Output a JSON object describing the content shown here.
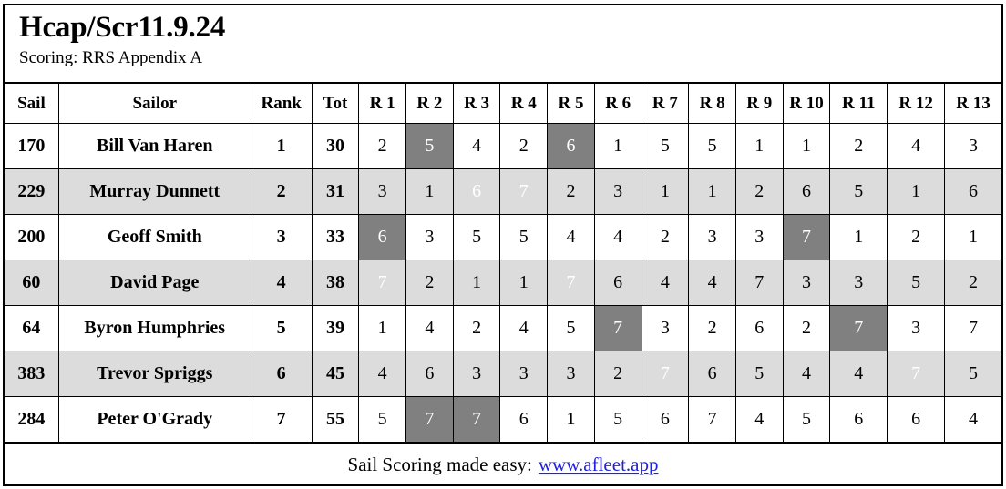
{
  "report": {
    "title": "Hcap/Scr11.9.24",
    "subtitle": "Scoring: RRS Appendix A"
  },
  "table": {
    "headers": {
      "sail": "Sail",
      "sailor": "Sailor",
      "rank": "Rank",
      "tot": "Tot",
      "races": [
        "R 1",
        "R 2",
        "R 3",
        "R 4",
        "R 5",
        "R 6",
        "R 7",
        "R 8",
        "R 9",
        "R 10",
        "R 11",
        "R 12",
        "R 13"
      ]
    },
    "rows": [
      {
        "sail": "170",
        "sailor": "Bill Van Haren",
        "rank": "1",
        "tot": "30",
        "races": [
          "2",
          "5",
          "4",
          "2",
          "6",
          "1",
          "5",
          "5",
          "1",
          "1",
          "2",
          "4",
          "3"
        ],
        "discards": [
          1,
          4
        ]
      },
      {
        "sail": "229",
        "sailor": "Murray Dunnett",
        "rank": "2",
        "tot": "31",
        "races": [
          "3",
          "1",
          "6",
          "7",
          "2",
          "3",
          "1",
          "1",
          "2",
          "6",
          "5",
          "1",
          "6"
        ],
        "discards": [
          2,
          3
        ]
      },
      {
        "sail": "200",
        "sailor": "Geoff Smith",
        "rank": "3",
        "tot": "33",
        "races": [
          "6",
          "3",
          "5",
          "5",
          "4",
          "4",
          "2",
          "3",
          "3",
          "7",
          "1",
          "2",
          "1"
        ],
        "discards": [
          0,
          9
        ]
      },
      {
        "sail": "60",
        "sailor": "David Page",
        "rank": "4",
        "tot": "38",
        "races": [
          "7",
          "2",
          "1",
          "1",
          "7",
          "6",
          "4",
          "4",
          "7",
          "3",
          "3",
          "5",
          "2"
        ],
        "discards": [
          0,
          4
        ]
      },
      {
        "sail": "64",
        "sailor": "Byron Humphries",
        "rank": "5",
        "tot": "39",
        "races": [
          "1",
          "4",
          "2",
          "4",
          "5",
          "7",
          "3",
          "2",
          "6",
          "2",
          "7",
          "3",
          "7"
        ],
        "discards": [
          5,
          10
        ]
      },
      {
        "sail": "383",
        "sailor": "Trevor Spriggs",
        "rank": "6",
        "tot": "45",
        "races": [
          "4",
          "6",
          "3",
          "3",
          "3",
          "2",
          "7",
          "6",
          "5",
          "4",
          "4",
          "7",
          "5"
        ],
        "discards": [
          6,
          11
        ]
      },
      {
        "sail": "284",
        "sailor": "Peter O'Grady",
        "rank": "7",
        "tot": "55",
        "races": [
          "5",
          "7",
          "7",
          "6",
          "1",
          "5",
          "6",
          "7",
          "4",
          "5",
          "6",
          "6",
          "4"
        ],
        "discards": [
          1,
          2
        ]
      }
    ]
  },
  "footer": {
    "text": "Sail Scoring made easy:",
    "link_label": "www.afleet.app"
  },
  "colors": {
    "discard_bg": "#808080",
    "alt_row_bg": "#dcdcdc",
    "link": "#2020e0",
    "border": "#000000"
  }
}
